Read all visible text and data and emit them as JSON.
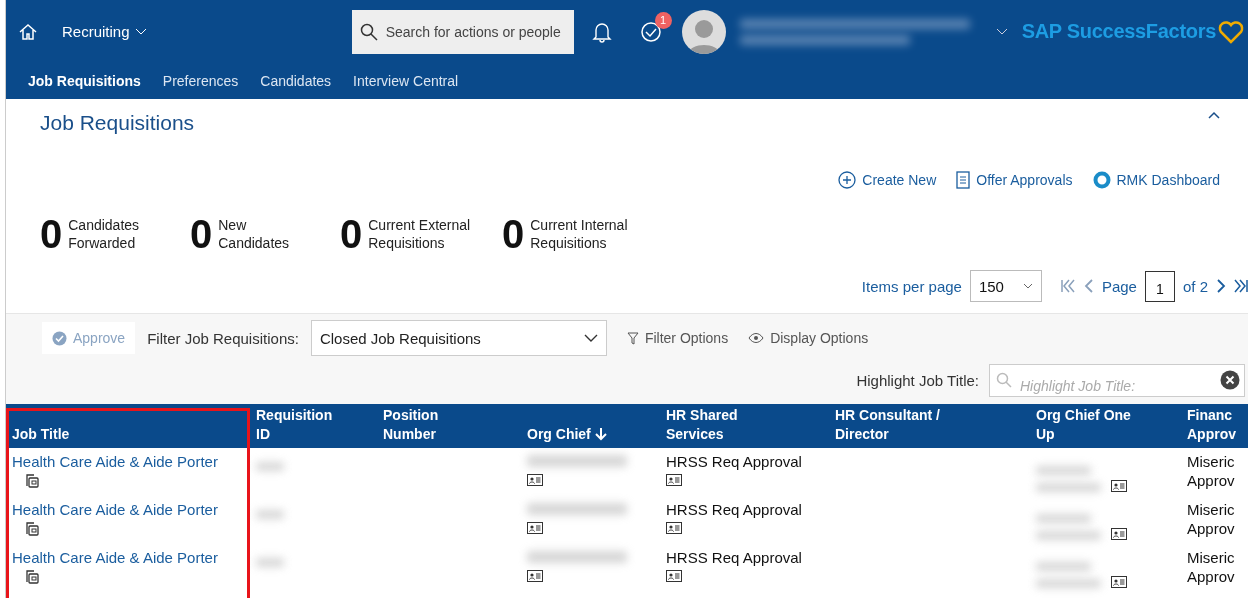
{
  "header": {
    "module": "Recruiting",
    "search": {
      "placeholder": "Search for actions or people"
    },
    "notifications_badge": "1",
    "brand": "SAP SuccessFactors"
  },
  "nav_tabs": [
    {
      "label": "Job Requisitions",
      "selected": true
    },
    {
      "label": "Preferences",
      "selected": false
    },
    {
      "label": "Candidates",
      "selected": false
    },
    {
      "label": "Interview Central",
      "selected": false
    }
  ],
  "page_title": "Job Requisitions",
  "actions": [
    "Create New",
    "Offer Approvals",
    "RMK Dashboard"
  ],
  "stats": [
    {
      "value": "0",
      "label": "Candidates Forwarded"
    },
    {
      "value": "0",
      "label": "New Candidates"
    },
    {
      "value": "0",
      "label": "Current External Requisitions"
    },
    {
      "value": "0",
      "label": "Current Internal Requisitions"
    }
  ],
  "pagination": {
    "items_label": "Items per page",
    "items_value": "150",
    "page_label": "Page",
    "page": "1",
    "of": "of 2"
  },
  "toolbar": {
    "approve": {
      "label": "Approve",
      "disabled": true
    },
    "filter_label": "Filter Job Requisitions:",
    "filter_value": "Closed Job Requisitions",
    "filter_options": "Filter Options",
    "display_options": "Display Options",
    "highlight_label": "Highlight Job Title:",
    "highlight_placeholder": "Highlight Job Title:"
  },
  "table": {
    "columns": [
      {
        "label": "Job Title",
        "sorted": false
      },
      {
        "label": "Requisition ID",
        "sorted": false
      },
      {
        "label": "Position Number",
        "sorted": false
      },
      {
        "label": "Org Chief",
        "sorted": true
      },
      {
        "label": "HR Shared Services",
        "sorted": false
      },
      {
        "label": "HR Consultant / Director",
        "sorted": false
      },
      {
        "label": "Org Chief One Up",
        "sorted": false
      },
      {
        "label": "Financ Approv",
        "sorted": false
      }
    ],
    "rows": [
      {
        "job_title": "Health Care Aide & Aide Porter",
        "hr_shared": "HRSS Req Approval",
        "finance": "Miseric Approv"
      },
      {
        "job_title": "Health Care Aide & Aide Porter",
        "hr_shared": "HRSS Req Approval",
        "finance": "Miseric Approv"
      },
      {
        "job_title": "Health Care Aide & Aide Porter",
        "hr_shared": "HRSS Req Approval",
        "finance": "Miseric Approv"
      }
    ]
  }
}
